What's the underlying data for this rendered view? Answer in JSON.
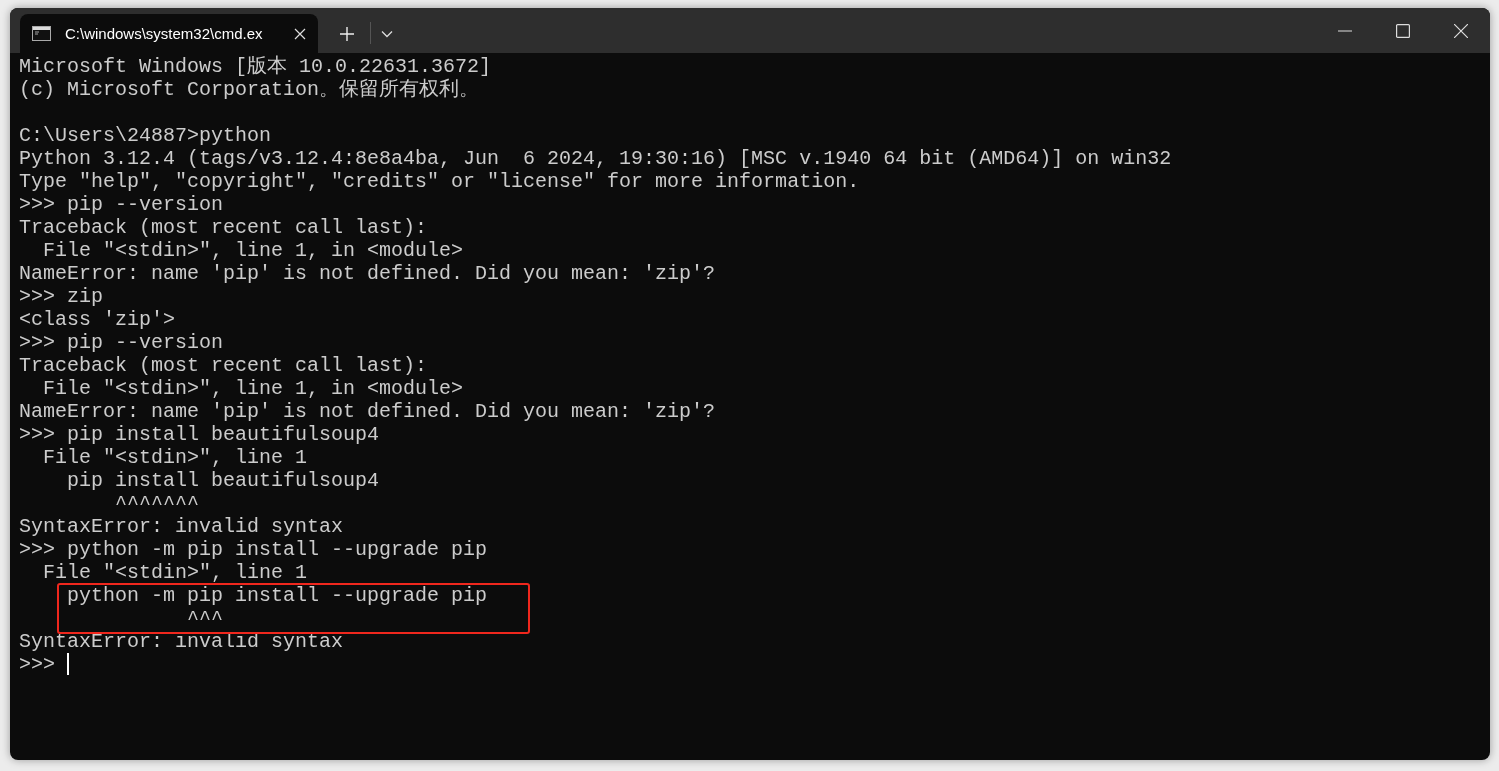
{
  "window": {
    "tabs": [
      {
        "title": "C:\\windows\\system32\\cmd.ex",
        "selected": true
      }
    ]
  },
  "terminal": {
    "lines": [
      {
        "text": "Microsoft Windows [版本 10.0.22631.3672]"
      },
      {
        "text": "(c) Microsoft Corporation。保留所有权利。"
      },
      {
        "text": "C:\\Users\\24887>python",
        "blank_before": true
      },
      {
        "text": "Python 3.12.4 (tags/v3.12.4:8e8a4ba, Jun  6 2024, 19:30:16) [MSC v.1940 64 bit (AMD64)] on win32"
      },
      {
        "text": "Type \"help\", \"copyright\", \"credits\" or \"license\" for more information."
      },
      {
        "text": ">>> pip --version"
      },
      {
        "text": "Traceback (most recent call last):"
      },
      {
        "text": "  File \"<stdin>\", line 1, in <module>"
      },
      {
        "text": "NameError: name 'pip' is not defined. Did you mean: 'zip'?"
      },
      {
        "text": ">>> zip"
      },
      {
        "text": "<class 'zip'>"
      },
      {
        "text": ">>> pip --version"
      },
      {
        "text": "Traceback (most recent call last):"
      },
      {
        "text": "  File \"<stdin>\", line 1, in <module>"
      },
      {
        "text": "NameError: name 'pip' is not defined. Did you mean: 'zip'?"
      },
      {
        "text": ">>> pip install beautifulsoup4"
      },
      {
        "text": "  File \"<stdin>\", line 1"
      },
      {
        "text": "    pip install beautifulsoup4"
      },
      {
        "text": "        ^^^^^^^"
      },
      {
        "text": "SyntaxError: invalid syntax"
      },
      {
        "text": ">>> python -m pip install --upgrade pip"
      },
      {
        "text": "  File \"<stdin>\", line 1"
      },
      {
        "text": "    python -m pip install --upgrade pip",
        "boxed": true
      },
      {
        "text": "              ^^^",
        "boxed": true
      },
      {
        "text": "SyntaxError: invalid syntax"
      },
      {
        "text": ">>> ",
        "cursor": true
      }
    ]
  }
}
